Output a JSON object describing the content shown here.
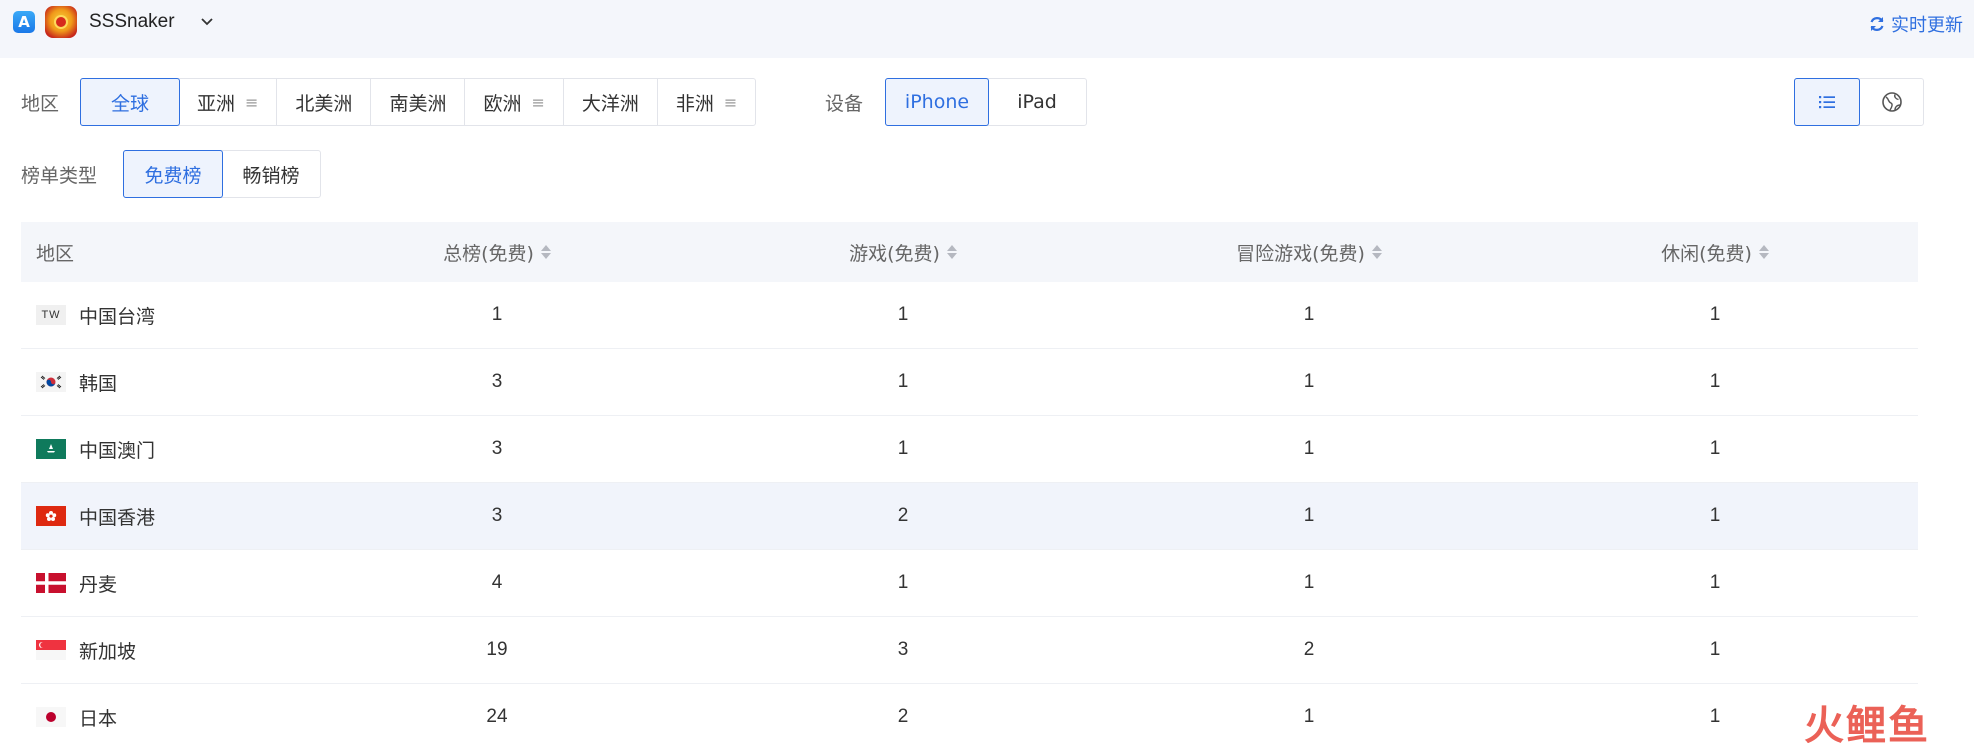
{
  "header": {
    "app_name": "SSSnaker",
    "refresh_label": "实时更新",
    "appstore_glyph": "A"
  },
  "filters": {
    "region_label": "地区",
    "regions": [
      {
        "label": "全球",
        "active": true,
        "has_menu": false
      },
      {
        "label": "亚洲",
        "active": false,
        "has_menu": true
      },
      {
        "label": "北美洲",
        "active": false,
        "has_menu": false
      },
      {
        "label": "南美洲",
        "active": false,
        "has_menu": false
      },
      {
        "label": "欧洲",
        "active": false,
        "has_menu": true
      },
      {
        "label": "大洋洲",
        "active": false,
        "has_menu": false
      },
      {
        "label": "非洲",
        "active": false,
        "has_menu": true
      }
    ],
    "device_label": "设备",
    "devices": [
      {
        "label": "iPhone",
        "active": true
      },
      {
        "label": "iPad",
        "active": false
      }
    ],
    "chart_type_label": "榜单类型",
    "chart_types": [
      {
        "label": "免费榜",
        "active": true
      },
      {
        "label": "畅销榜",
        "active": false
      }
    ],
    "menu_glyph": "≡"
  },
  "view_toggle": {
    "list_icon": "list-icon",
    "globe_icon": "globe-icon",
    "active": "list"
  },
  "table": {
    "headers": {
      "region": "地区",
      "col1": "总榜(免费)",
      "col2": "游戏(免费)",
      "col3": "冒险游戏(免费)",
      "col4": "休闲(免费)"
    },
    "rows": [
      {
        "flag": "TW",
        "region": "中国台湾",
        "v1": "1",
        "v2": "1",
        "v3": "1",
        "v4": "1"
      },
      {
        "flag": "kr",
        "region": "韩国",
        "v1": "3",
        "v2": "1",
        "v3": "1",
        "v4": "1"
      },
      {
        "flag": "mo",
        "region": "中国澳门",
        "v1": "3",
        "v2": "1",
        "v3": "1",
        "v4": "1"
      },
      {
        "flag": "hk",
        "region": "中国香港",
        "v1": "3",
        "v2": "2",
        "v3": "1",
        "v4": "1"
      },
      {
        "flag": "dk",
        "region": "丹麦",
        "v1": "4",
        "v2": "1",
        "v3": "1",
        "v4": "1"
      },
      {
        "flag": "sg",
        "region": "新加坡",
        "v1": "19",
        "v2": "3",
        "v3": "2",
        "v4": "1"
      },
      {
        "flag": "jp",
        "region": "日本",
        "v1": "24",
        "v2": "2",
        "v3": "1",
        "v4": "1"
      }
    ]
  },
  "watermark": "火鲤鱼",
  "colors": {
    "accent": "#2f6fe0",
    "active_bg": "#eef3fd",
    "header_bg": "#f4f6fa",
    "highlight_row": "#f1f4fb"
  }
}
